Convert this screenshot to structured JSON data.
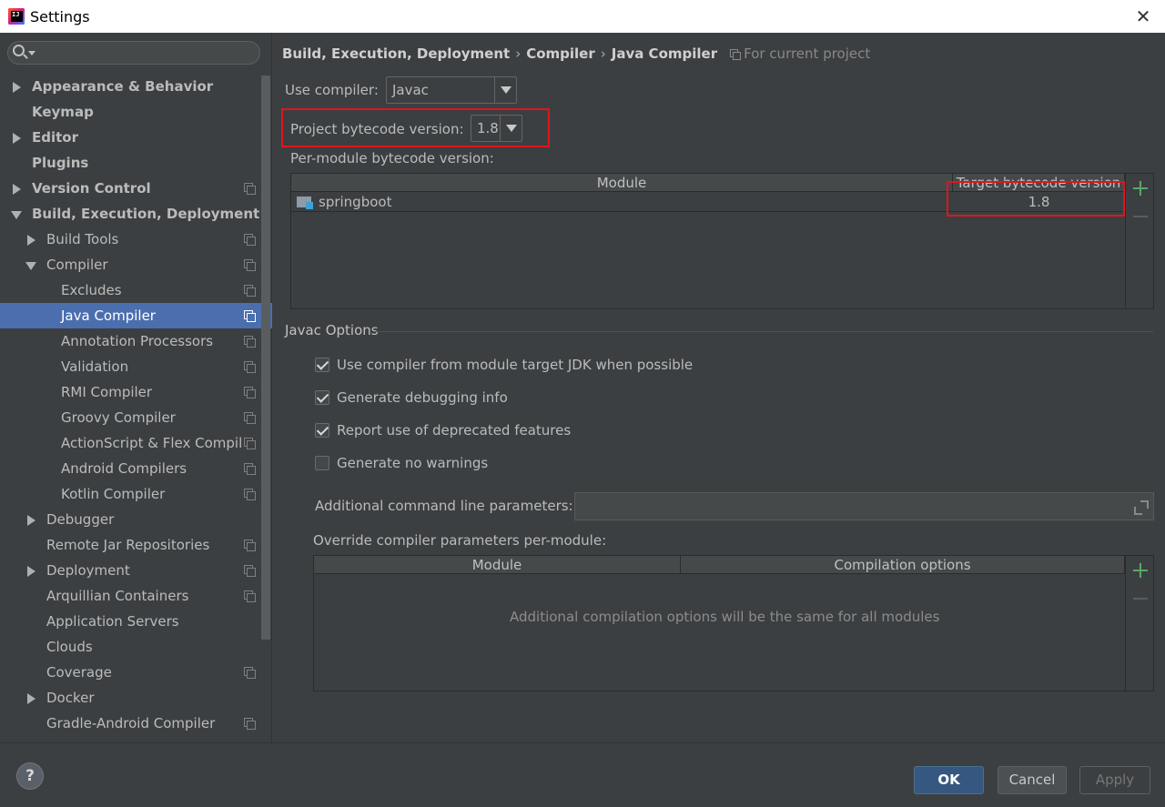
{
  "window": {
    "title": "Settings",
    "close_glyph": "✕"
  },
  "search": {
    "placeholder": ""
  },
  "sidebar": {
    "items": [
      {
        "label": "Appearance & Behavior"
      },
      {
        "label": "Keymap"
      },
      {
        "label": "Editor"
      },
      {
        "label": "Plugins"
      },
      {
        "label": "Version Control"
      },
      {
        "label": "Build, Execution, Deployment"
      },
      {
        "label": "Build Tools"
      },
      {
        "label": "Compiler"
      },
      {
        "label": "Excludes"
      },
      {
        "label": "Java Compiler"
      },
      {
        "label": "Annotation Processors"
      },
      {
        "label": "Validation"
      },
      {
        "label": "RMI Compiler"
      },
      {
        "label": "Groovy Compiler"
      },
      {
        "label": "ActionScript & Flex Compil"
      },
      {
        "label": "Android Compilers"
      },
      {
        "label": "Kotlin Compiler"
      },
      {
        "label": "Debugger"
      },
      {
        "label": "Remote Jar Repositories"
      },
      {
        "label": "Deployment"
      },
      {
        "label": "Arquillian Containers"
      },
      {
        "label": "Application Servers"
      },
      {
        "label": "Clouds"
      },
      {
        "label": "Coverage"
      },
      {
        "label": "Docker"
      },
      {
        "label": "Gradle-Android Compiler"
      }
    ]
  },
  "breadcrumb": {
    "part1": "Build, Execution, Deployment",
    "part2": "Compiler",
    "part3": "Java Compiler",
    "separator": "›",
    "scope": "For current project"
  },
  "compiler": {
    "use_label": "Use compiler:",
    "use_value": "Javac",
    "bytecode_label": "Project bytecode version:",
    "bytecode_value": "1.8",
    "per_module_label": "Per-module bytecode version:"
  },
  "module_table": {
    "headers": [
      "Module",
      "Target bytecode version"
    ],
    "rows": [
      {
        "module": "springboot",
        "target": "1.8"
      }
    ]
  },
  "javac": {
    "title": "Javac Options",
    "options": [
      {
        "label": "Use compiler from module target JDK when possible",
        "checked": true
      },
      {
        "label": "Generate debugging info",
        "checked": true
      },
      {
        "label": "Report use of deprecated features",
        "checked": true
      },
      {
        "label": "Generate no warnings",
        "checked": false
      }
    ],
    "additional_label": "Additional command line parameters:",
    "additional_value": "",
    "override_label": "Override compiler parameters per-module:"
  },
  "override_table": {
    "headers": [
      "Module",
      "Compilation options"
    ],
    "empty_text": "Additional compilation options will be the same for all modules"
  },
  "footer": {
    "help": "?",
    "ok": "OK",
    "cancel": "Cancel",
    "apply": "Apply"
  },
  "colors": {
    "selection": "#4b6eaf",
    "highlight_box": "#e0141e",
    "add_green": "#59a869",
    "ok_button": "#365880"
  }
}
